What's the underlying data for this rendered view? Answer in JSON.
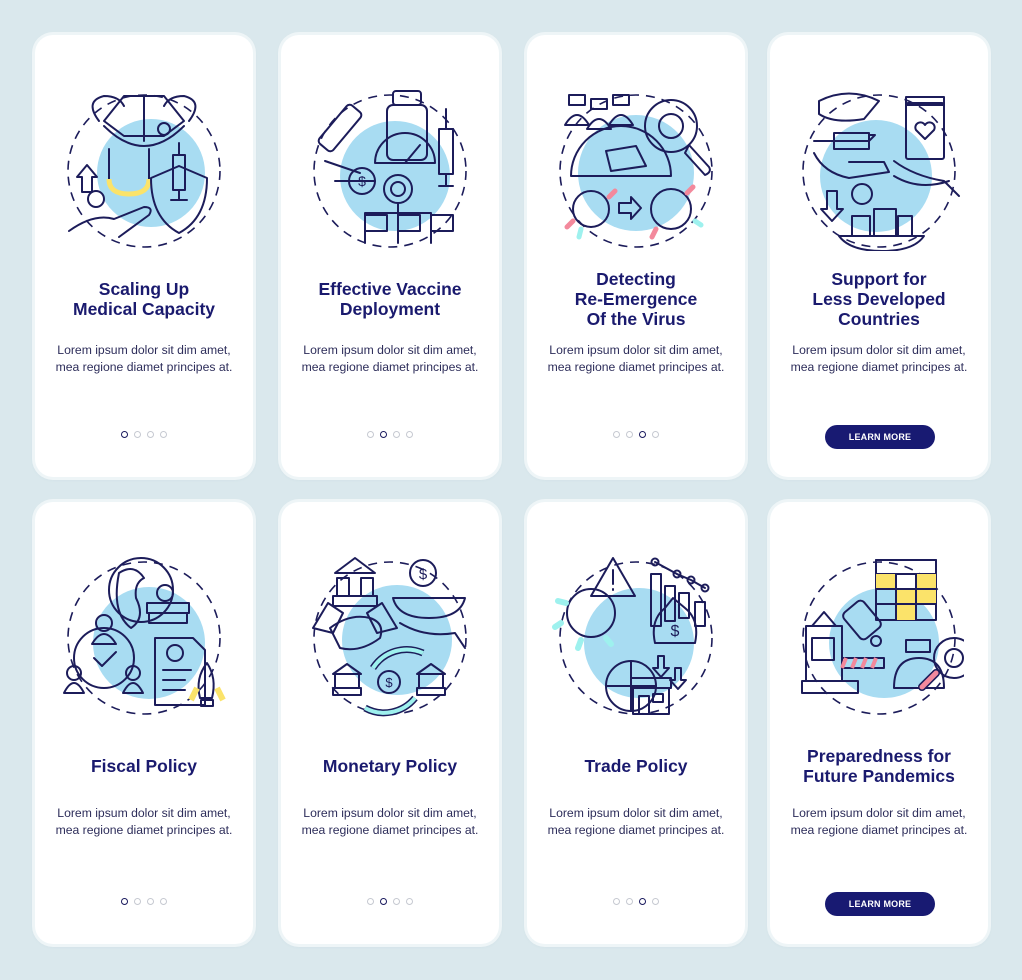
{
  "colors": {
    "background": "#dae8ed",
    "card": "#ffffff",
    "title": "#1a1a6e",
    "body_text": "#2d2d5a",
    "button": "#181a72",
    "dot_active": "#1a1a5e",
    "dot_inactive": "#c6c9d1",
    "blob": "#a8dcf2",
    "accent_cyan": "#9ef1ee",
    "accent_yellow": "#fbe36a",
    "accent_pink": "#f3899c"
  },
  "screens": [
    {
      "title_lines": [
        "Scaling Up",
        "Medical Capacity"
      ],
      "body": "Lorem ipsum dolor sit dim amet, mea regione diamet principes at.",
      "illustration": "medical-capacity-icon",
      "page_index": 1,
      "page_count": 4,
      "action": null
    },
    {
      "title_lines": [
        "Effective Vaccine",
        "Deployment"
      ],
      "body": "Lorem ipsum dolor sit dim amet, mea regione diamet principes at.",
      "illustration": "vaccine-deployment-icon",
      "page_index": 2,
      "page_count": 4,
      "action": null
    },
    {
      "title_lines": [
        "Detecting",
        "Re-Emergence",
        "Of the Virus"
      ],
      "body": "Lorem ipsum dolor sit dim amet, mea regione diamet principes at.",
      "illustration": "virus-detection-icon",
      "page_index": 3,
      "page_count": 4,
      "action": null
    },
    {
      "title_lines": [
        "Support for",
        "Less Developed",
        "Countries"
      ],
      "body": "Lorem ipsum dolor sit dim amet, mea regione diamet principes at.",
      "illustration": "developing-countries-support-icon",
      "page_index": 4,
      "page_count": 4,
      "action": "LEARN MORE"
    },
    {
      "title_lines": [
        "Fiscal Policy"
      ],
      "body": "Lorem ipsum dolor sit dim amet, mea regione diamet principes at.",
      "illustration": "fiscal-policy-icon",
      "page_index": 1,
      "page_count": 4,
      "action": null
    },
    {
      "title_lines": [
        "Monetary Policy"
      ],
      "body": "Lorem ipsum dolor sit dim amet, mea regione diamet principes at.",
      "illustration": "monetary-policy-icon",
      "page_index": 2,
      "page_count": 4,
      "action": null
    },
    {
      "title_lines": [
        "Trade Policy"
      ],
      "body": "Lorem ipsum dolor sit dim amet, mea regione diamet principes at.",
      "illustration": "trade-policy-icon",
      "page_index": 3,
      "page_count": 4,
      "action": null
    },
    {
      "title_lines": [
        "Preparedness for",
        "Future Pandemics"
      ],
      "body": "Lorem ipsum dolor sit dim amet, mea regione diamet principes at.",
      "illustration": "pandemic-preparedness-icon",
      "page_index": 4,
      "page_count": 4,
      "action": "LEARN MORE"
    }
  ]
}
